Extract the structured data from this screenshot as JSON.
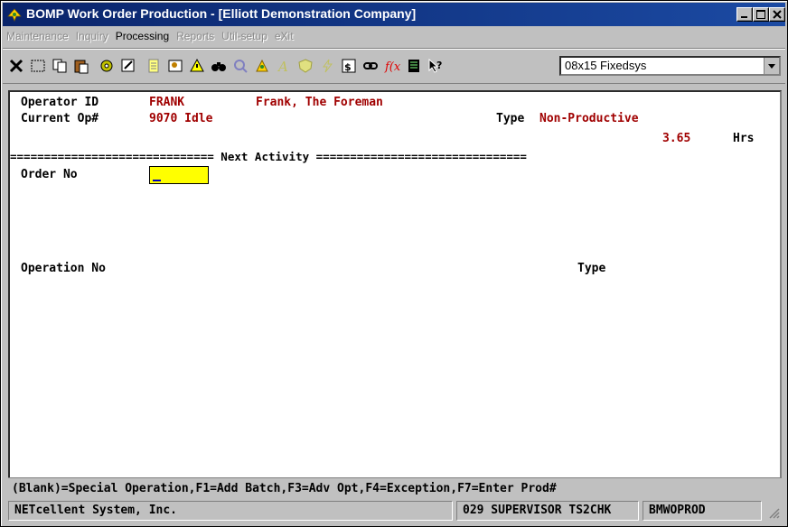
{
  "window": {
    "title": "BOMP Work Order Production - [Elliott Demonstration Company]"
  },
  "menu": [
    {
      "label": "Maintenance",
      "enabled": false
    },
    {
      "label": "Inquiry",
      "enabled": false
    },
    {
      "label": "Processing",
      "enabled": true
    },
    {
      "label": "Reports",
      "enabled": false
    },
    {
      "label": "Util-setup",
      "enabled": false
    },
    {
      "label": "eXit",
      "enabled": false
    }
  ],
  "toolbar": {
    "icons": [
      "close-x-icon",
      "select-rectangle-icon",
      "copy-icon",
      "paste-icon",
      "settings-gear-icon",
      "properties-icon",
      "document-icon",
      "user-card-icon",
      "warning-icon",
      "binoculars-icon",
      "search-icon",
      "rocket-icon",
      "font-a-icon",
      "shield-icon",
      "lightning-icon",
      "calculator-icon",
      "link-icon",
      "function-icon",
      "notebook-icon",
      "help-pointer-icon"
    ],
    "font_select": "08x15 Fixedsys"
  },
  "form": {
    "operator_id_label": "Operator ID",
    "operator_id": "FRANK",
    "operator_name": "Frank, The Foreman",
    "current_op_label": "Current Op#",
    "current_op": "9070 Idle",
    "type_label": "Type",
    "type_value": "Non-Productive",
    "hours_value": "3.65",
    "hours_label": "Hrs",
    "divider": "============================== Next Activity ===============================",
    "order_no_label": "Order No",
    "order_no_value": "",
    "operation_no_label": "Operation No",
    "type2_label": "Type"
  },
  "hint_line": "(Blank)=Special Operation,F1=Add Batch,F3=Adv Opt,F4=Exception,F7=Enter Prod#",
  "status": {
    "company": "NETcellent System, Inc.",
    "user": "029 SUPERVISOR TS2CHK",
    "program": "BMWOPROD"
  },
  "colors": {
    "titlebar": "#0a246a",
    "accent_red": "#a00000",
    "input_highlight": "#ffff00"
  }
}
